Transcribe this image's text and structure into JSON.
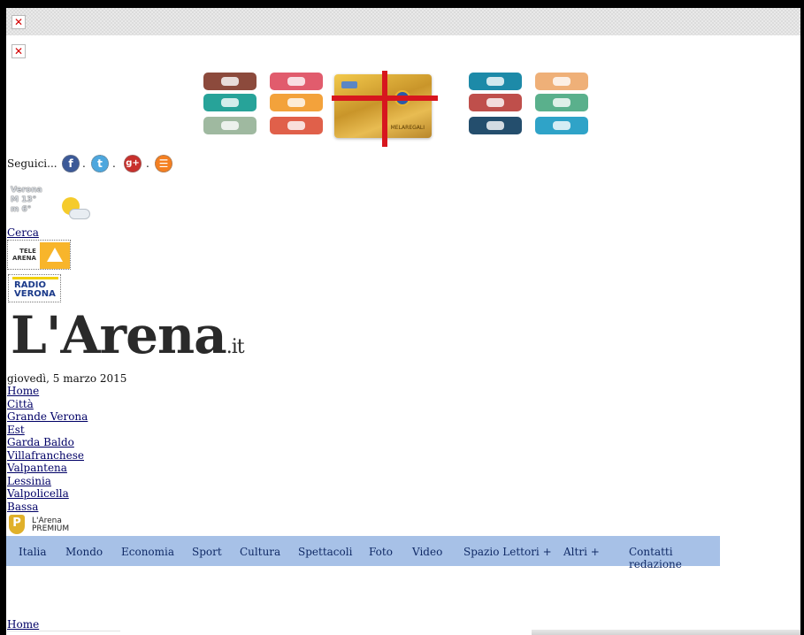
{
  "broken_images": [
    "✕",
    "✕"
  ],
  "promo_card": {
    "label": "MELAREGALI"
  },
  "follow": {
    "label": "Seguici...",
    "separators": [
      ".",
      ".",
      "."
    ],
    "networks": [
      {
        "name": "facebook-icon",
        "glyph": "f",
        "color": "#3b5998"
      },
      {
        "name": "twitter-icon",
        "glyph": "t",
        "color": "#4da7de"
      },
      {
        "name": "googleplus-icon",
        "glyph": "g+",
        "color": "#c8302c"
      },
      {
        "name": "rss-icon",
        "glyph": "☰",
        "color": "#f47f21"
      }
    ]
  },
  "weather": {
    "city": "Verona",
    "max": "M 13°",
    "min": "m 6°"
  },
  "search_link": "Cerca",
  "telearena": {
    "line1": "TELE",
    "line2": "ARENA"
  },
  "radioverona": {
    "line1": "RADIO",
    "line2": "VERONA"
  },
  "logo": {
    "name": "L'Arena",
    "suffix": ".it"
  },
  "date": "giovedì, 5 marzo 2015",
  "local_nav": [
    "Home",
    "Città",
    "Grande Verona",
    "Est",
    "Garda Baldo",
    "Villafranchese",
    "Valpantena",
    "Lessinia",
    "Valpolicella",
    "Bassa"
  ],
  "premium": {
    "badge": "P",
    "line1": "L'Arena",
    "line2": "PREMIUM"
  },
  "main_menu": [
    "Italia",
    "Mondo",
    "Economia",
    "Sport",
    "Cultura",
    "Spettacoli",
    "Foto",
    "Video",
    "Spazio Lettori +",
    "Altri +",
    "Contatti redazione"
  ],
  "breadcrumb_home": "Home",
  "colors": {
    "menu_bg": "#a7c1e7",
    "link": "#000066"
  }
}
